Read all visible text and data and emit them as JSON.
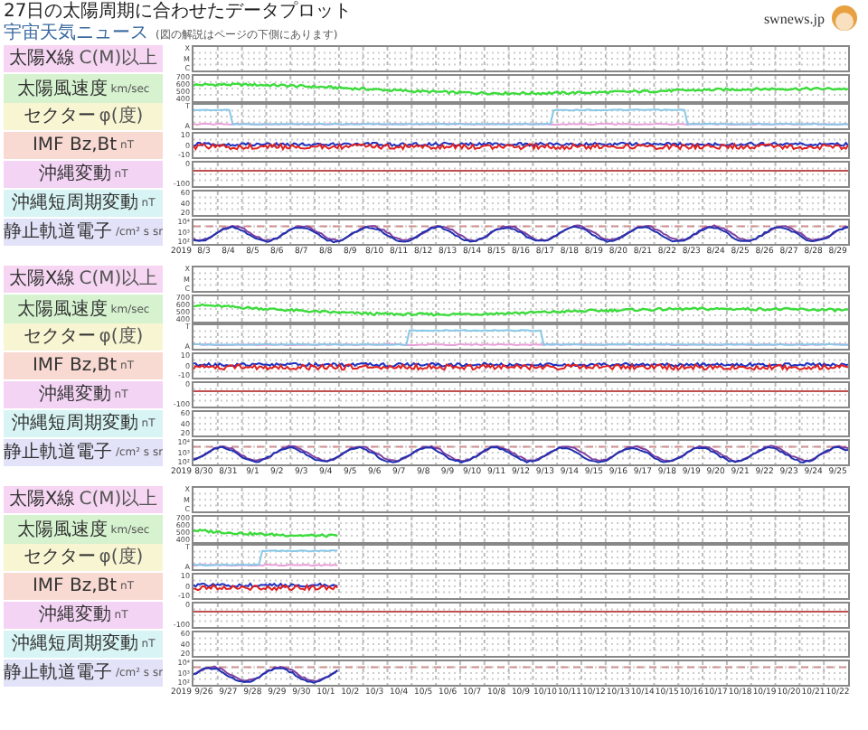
{
  "header": {
    "title": "27日の太陽周期に合わせたデータプロット",
    "subtitle": "宇宙天気ニュース",
    "note": "(図の解説はページの下側にあります)",
    "logo": "swnews.jp"
  },
  "panels": [
    {
      "year": "2019",
      "partial": false,
      "dates": [
        "8/3",
        "8/4",
        "8/5",
        "8/6",
        "8/7",
        "8/8",
        "8/9",
        "8/10",
        "8/11",
        "8/12",
        "8/13",
        "8/14",
        "8/15",
        "8/16",
        "8/17",
        "8/18",
        "8/19",
        "8/20",
        "8/21",
        "8/22",
        "8/23",
        "8/24",
        "8/25",
        "8/26",
        "8/27",
        "8/28",
        "8/29"
      ],
      "rows": [
        {
          "kind": "xray",
          "name": "太陽X線",
          "unit": "C(M)以上",
          "ticks": [
            "X",
            "M",
            "C"
          ],
          "color": "#f6d6f2"
        },
        {
          "kind": "speed",
          "name": "太陽風速度",
          "unit": "km/sec",
          "ticks": [
            "700",
            "600",
            "500",
            "400"
          ],
          "color": "#d6f2cf"
        },
        {
          "kind": "sector",
          "name": "セクター",
          "unit": "φ(度)",
          "ticks": [
            "T",
            "A"
          ],
          "color": "#f8f5d2"
        },
        {
          "kind": "imf",
          "name": "IMF Bz,Bt",
          "unit": "nT",
          "ticks": [
            "10",
            "0",
            "-10"
          ],
          "color": "#f8dad2"
        },
        {
          "kind": "mag",
          "name": "沖縄変動",
          "unit": "nT",
          "ticks": [
            "0",
            "-100"
          ],
          "color": "#f4d4f4"
        },
        {
          "kind": "short",
          "name": "沖縄短周期変動",
          "unit": "nT",
          "ticks": [
            "60",
            "40",
            "20"
          ],
          "color": "#d8f4f4"
        },
        {
          "kind": "electron",
          "name": "静止軌道電子",
          "unit": "/cm² s sr",
          "ticks": [
            "10⁴",
            "10³",
            "10²"
          ],
          "color": "#e2e2f8"
        }
      ]
    },
    {
      "year": "2019",
      "partial": false,
      "dates": [
        "8/30",
        "8/31",
        "9/1",
        "9/2",
        "9/3",
        "9/4",
        "9/5",
        "9/6",
        "9/7",
        "9/8",
        "9/9",
        "9/10",
        "9/11",
        "9/12",
        "9/13",
        "9/14",
        "9/15",
        "9/16",
        "9/17",
        "9/18",
        "9/19",
        "9/20",
        "9/21",
        "9/22",
        "9/23",
        "9/24",
        "9/25"
      ],
      "rows": [
        {
          "kind": "xray",
          "name": "太陽X線",
          "unit": "C(M)以上",
          "ticks": [
            "X",
            "M",
            "C"
          ],
          "color": "#f6d6f2"
        },
        {
          "kind": "speed",
          "name": "太陽風速度",
          "unit": "km/sec",
          "ticks": [
            "700",
            "600",
            "500",
            "400"
          ],
          "color": "#d6f2cf"
        },
        {
          "kind": "sector",
          "name": "セクター",
          "unit": "φ(度)",
          "ticks": [
            "T",
            "A"
          ],
          "color": "#f8f5d2"
        },
        {
          "kind": "imf",
          "name": "IMF Bz,Bt",
          "unit": "nT",
          "ticks": [
            "10",
            "0",
            "-10"
          ],
          "color": "#f8dad2"
        },
        {
          "kind": "mag",
          "name": "沖縄変動",
          "unit": "nT",
          "ticks": [
            "0",
            "-100"
          ],
          "color": "#f4d4f4"
        },
        {
          "kind": "short",
          "name": "沖縄短周期変動",
          "unit": "nT",
          "ticks": [
            "60",
            "40",
            "20"
          ],
          "color": "#d8f4f4"
        },
        {
          "kind": "electron",
          "name": "静止軌道電子",
          "unit": "/cm² s sr",
          "ticks": [
            "10⁴",
            "10³",
            "10²"
          ],
          "color": "#e2e2f8"
        }
      ]
    },
    {
      "year": "2019",
      "partial": true,
      "dates": [
        "9/26",
        "9/27",
        "9/28",
        "9/29",
        "9/30",
        "10/1",
        "10/2",
        "10/3",
        "10/4",
        "10/5",
        "10/6",
        "10/7",
        "10/8",
        "10/9",
        "10/10",
        "10/11",
        "10/12",
        "10/13",
        "10/14",
        "10/15",
        "10/16",
        "10/17",
        "10/18",
        "10/19",
        "10/20",
        "10/21",
        "10/22"
      ],
      "rows": [
        {
          "kind": "xray",
          "name": "太陽X線",
          "unit": "C(M)以上",
          "ticks": [
            "X",
            "M",
            "C"
          ],
          "color": "#f6d6f2"
        },
        {
          "kind": "speed",
          "name": "太陽風速度",
          "unit": "km/sec",
          "ticks": [
            "700",
            "600",
            "500",
            "400"
          ],
          "color": "#d6f2cf"
        },
        {
          "kind": "sector",
          "name": "セクター",
          "unit": "φ(度)",
          "ticks": [
            "T",
            "A"
          ],
          "color": "#f8f5d2"
        },
        {
          "kind": "imf",
          "name": "IMF Bz,Bt",
          "unit": "nT",
          "ticks": [
            "10",
            "0",
            "-10"
          ],
          "color": "#f8dad2"
        },
        {
          "kind": "mag",
          "name": "沖縄変動",
          "unit": "nT",
          "ticks": [
            "0",
            "-100"
          ],
          "color": "#f4d4f4"
        },
        {
          "kind": "short",
          "name": "沖縄短周期変動",
          "unit": "nT",
          "ticks": [
            "60",
            "40",
            "20"
          ],
          "color": "#d8f4f4"
        },
        {
          "kind": "electron",
          "name": "静止軌道電子",
          "unit": "/cm² s sr",
          "ticks": [
            "10⁴",
            "10³",
            "10²"
          ],
          "color": "#e2e2f8"
        }
      ]
    }
  ]
}
